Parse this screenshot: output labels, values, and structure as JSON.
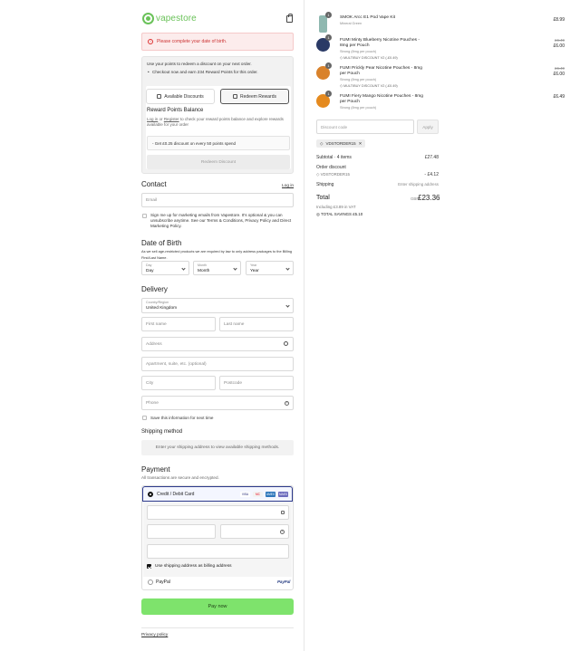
{
  "brand": {
    "logo_text": "vapestore"
  },
  "icons": {
    "bag": "shopping-bag-icon",
    "error": "alert-circle-icon",
    "tag": "tag-icon",
    "lock": "lock-icon",
    "help": "help-circle-icon",
    "search": "search-icon"
  },
  "colors": {
    "accent": "#6ac259",
    "pay_button": "#7ee36c",
    "error_bg": "#fcecec",
    "error_text": "#cc3333",
    "selected_border": "#2d3a8c"
  },
  "error": {
    "message": "Please complete your date of birth."
  },
  "rewards": {
    "line1": "Use your points to redeem a discount on your next order.",
    "line2": "Checkout now and earn 234 Reward Points for this order.",
    "tab_available": "Available Discounts",
    "tab_redeem": "Redeem Rewards",
    "balance_title": "Reward Points Balance",
    "login_link": "Log in",
    "or_text": "or",
    "register_link": "Register",
    "balance_sub_rest": "to check your reward points balance and explore rewards available for your order",
    "tier": "- Get £0.25 discount on every 50 points spend",
    "redeem_button": "Redeem Discount"
  },
  "contact": {
    "title": "Contact",
    "login": "Log in",
    "email_placeholder": "Email",
    "marketing_text": "Sign me up for marketing emails from Vapestore. It's optional & you can unsubscribe anytime. See our Terms & Conditions, Privacy Policy and Direct Marketing Policy."
  },
  "dob": {
    "title": "Date of Birth",
    "note": "As we sell age-restricted products we are required by law to only address packages to the Billing First/Last Name.",
    "day_label": "Day",
    "day_value": "Day",
    "month_label": "Month",
    "month_value": "Month",
    "year_label": "Year",
    "year_value": "Year"
  },
  "delivery": {
    "title": "Delivery",
    "country_label": "Country/Region",
    "country_value": "United Kingdom",
    "first_name": "First name",
    "last_name": "Last name",
    "address": "Address",
    "apartment": "Apartment, suite, etc. (optional)",
    "city": "City",
    "postcode": "Postcode",
    "phone": "Phone",
    "save_info": "Save this information for next time"
  },
  "shipping": {
    "title": "Shipping method",
    "message": "Enter your shipping address to view available shipping methods."
  },
  "payment": {
    "title": "Payment",
    "subtitle": "All transactions are secure and encrypted.",
    "card_option": "Credit / Debit Card",
    "card_logos": [
      "VISA",
      "MC",
      "AMEX",
      "MAES"
    ],
    "billing_same": "Use shipping address as billing address",
    "paypal_option": "PayPal",
    "paypal_logo": "PayPal",
    "pay_button": "Pay now"
  },
  "footer": {
    "privacy": "Privacy policy"
  },
  "order": {
    "items": [
      {
        "qty": "1",
        "name": "SMOK Arcc E1 Pod Vape Kit",
        "sub": "Mineral Green",
        "discount": "",
        "old_price": "",
        "price": "£8.99",
        "color": "#8fb8b0"
      },
      {
        "qty": "1",
        "name": "FUMI Minty Blueberry Nicotine Pouches - 8mg per Pouch",
        "sub": "Strong (8mg per pouch)",
        "discount": "MULTIBUY DISCOUNT V2 (-£0.49)",
        "old_price": "£6.49",
        "price": "£6.00",
        "color": "#2a3a66"
      },
      {
        "qty": "1",
        "name": "FUMI Prickly Pear Nicotine Pouches - 8mg per Pouch",
        "sub": "Strong (8mg per pouch)",
        "discount": "MULTIBUY DISCOUNT V2 (-£0.49)",
        "old_price": "£6.49",
        "price": "£6.00",
        "color": "#d9822b"
      },
      {
        "qty": "1",
        "name": "FUMI Fiery Mango Nicotine Pouches - 8mg per Pouch",
        "sub": "Strong (8mg per pouch)",
        "discount": "",
        "old_price": "",
        "price": "£6.49",
        "color": "#e58a1f"
      }
    ],
    "discount_placeholder": "Discount code",
    "apply": "Apply",
    "code_chip": "VDSTORDER15",
    "subtotal_label": "Subtotal · 4 items",
    "subtotal_value": "£27.48",
    "order_discount_label": "Order discount",
    "order_discount_code": "VDSTORDER15",
    "order_discount_value": "- £4.12",
    "shipping_label": "Shipping",
    "shipping_value": "Enter shipping address",
    "total_label": "Total",
    "total_currency": "GBP",
    "total_value": "£23.36",
    "vat_note": "Including £3.89 in VAT",
    "savings": "TOTAL SAVINGS £5.10"
  }
}
